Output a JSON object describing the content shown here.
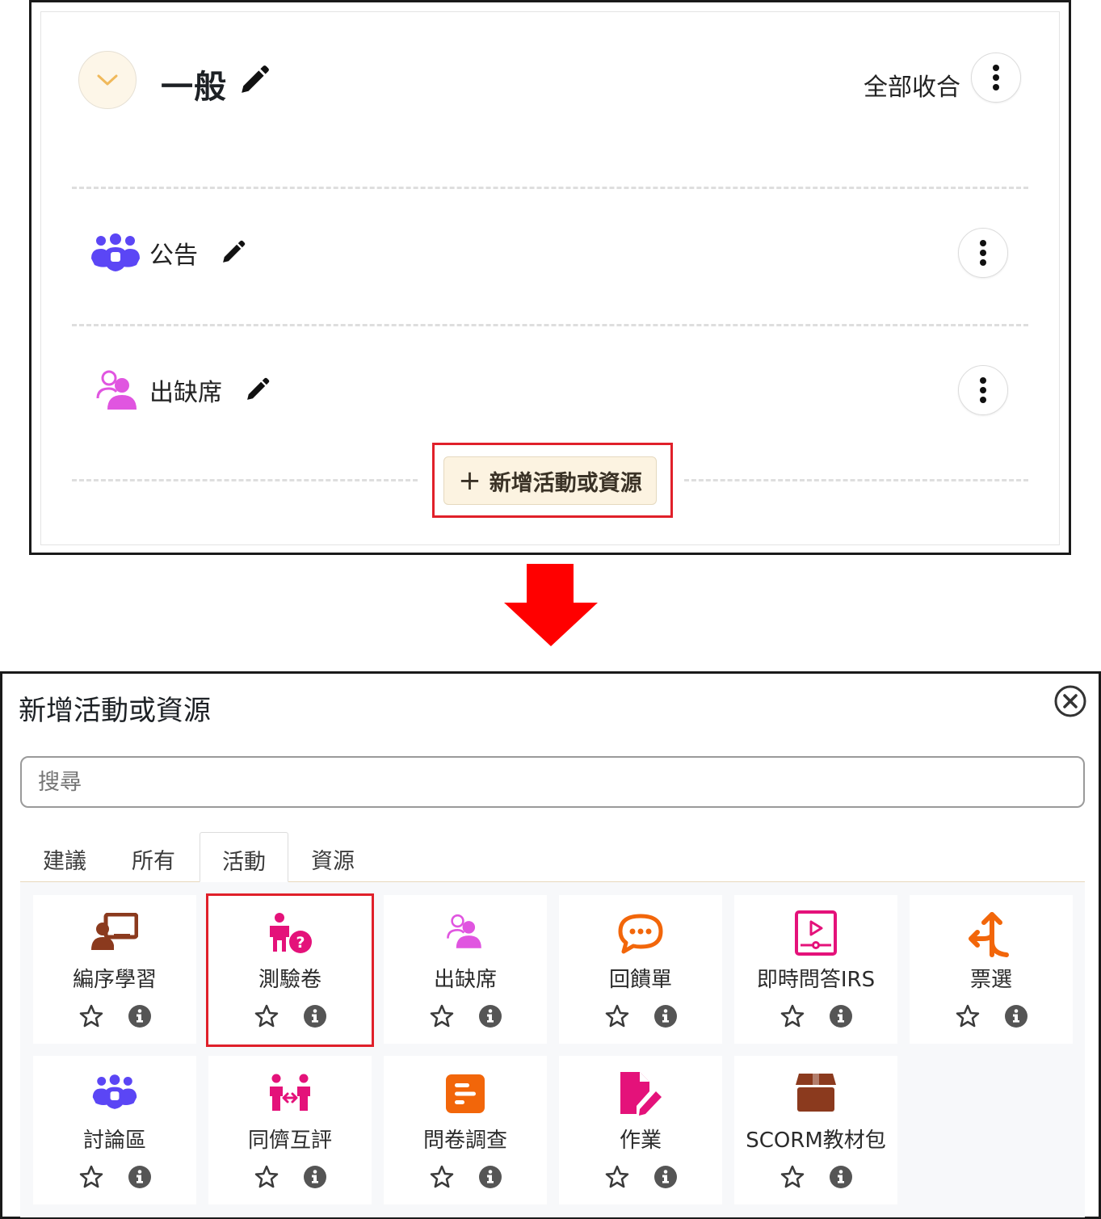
{
  "section": {
    "title": "一般",
    "collapse_all": "全部收合",
    "activities": [
      {
        "name": "公告",
        "icon": "forum-icon",
        "color": "#5b46f5"
      },
      {
        "name": "出缺席",
        "icon": "attendance-icon",
        "color": "#e055e0"
      }
    ],
    "add_button": "新增活動或資源"
  },
  "modal": {
    "title": "新增活動或資源",
    "search_placeholder": "搜尋",
    "tabs": [
      "建議",
      "所有",
      "活動",
      "資源"
    ],
    "active_tab": "活動",
    "items": [
      {
        "label": "編序學習",
        "icon": "lesson-icon",
        "color": "#8b3a1e"
      },
      {
        "label": "測驗卷",
        "icon": "quiz-icon",
        "color": "#e4127a"
      },
      {
        "label": "出缺席",
        "icon": "attendance-icon",
        "color": "#e055e0"
      },
      {
        "label": "回饋單",
        "icon": "feedback-icon",
        "color": "#f2660a"
      },
      {
        "label": "即時問答IRS",
        "icon": "irs-video-icon",
        "color": "#e4127a"
      },
      {
        "label": "票選",
        "icon": "choice-icon",
        "color": "#f2660a"
      },
      {
        "label": "討論區",
        "icon": "forum-icon",
        "color": "#5b46f5"
      },
      {
        "label": "同儕互評",
        "icon": "workshop-icon",
        "color": "#e4127a"
      },
      {
        "label": "問卷調查",
        "icon": "survey-icon",
        "color": "#f2660a"
      },
      {
        "label": "作業",
        "icon": "assignment-icon",
        "color": "#e4127a"
      },
      {
        "label": "SCORM教材包",
        "icon": "scorm-package-icon",
        "color": "#8b3a1e"
      }
    ],
    "highlighted_item": "測驗卷"
  },
  "colors": {
    "highlight": "#e0202a",
    "arrow": "#ff0000",
    "add_button_bg": "#fcf3e1"
  }
}
